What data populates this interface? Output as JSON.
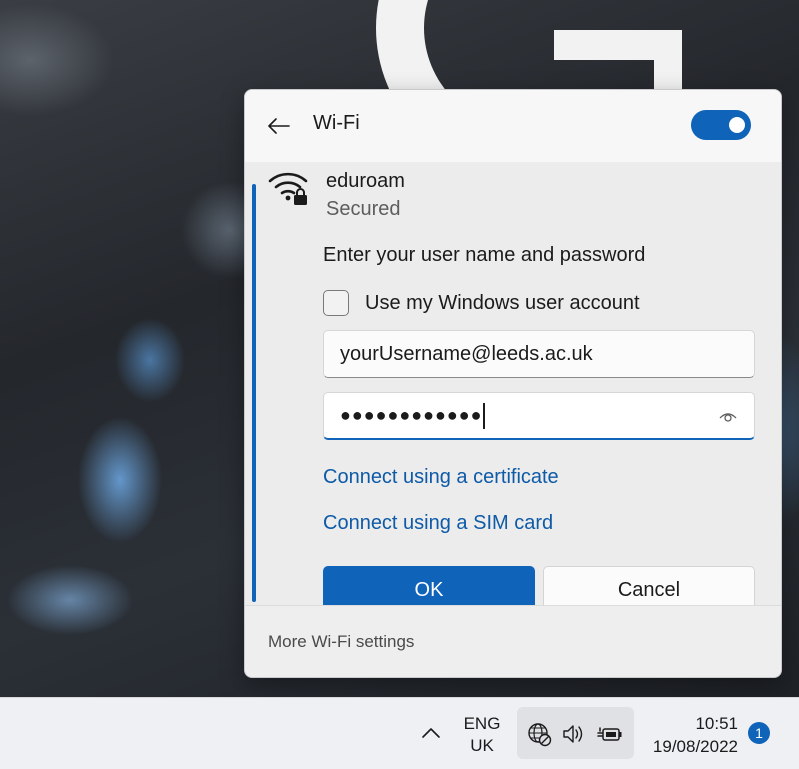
{
  "flyout": {
    "title": "Wi-Fi",
    "toggle_on": true,
    "accent_color": "#0f63b8"
  },
  "network": {
    "name": "eduroam",
    "status": "Secured",
    "icon": "wifi-secured-icon",
    "prompt": "Enter your user name and password",
    "checkbox_label": "Use my Windows user account",
    "checkbox_checked": false,
    "username_value": "yourUsername@leeds.ac.uk",
    "password_mask": "●●●●●●●●●●●●",
    "link_certificate": "Connect using a certificate",
    "link_sim": "Connect using a SIM card",
    "ok_label": "OK",
    "cancel_label": "Cancel"
  },
  "footer": {
    "more_settings": "More Wi-Fi settings"
  },
  "taskbar": {
    "lang_line1": "ENG",
    "lang_line2": "UK",
    "time": "10:51",
    "date": "19/08/2022",
    "notification_count": "1",
    "icons": [
      "chevron-up-icon",
      "globe-blocked-icon",
      "speaker-icon",
      "battery-charging-icon"
    ]
  }
}
